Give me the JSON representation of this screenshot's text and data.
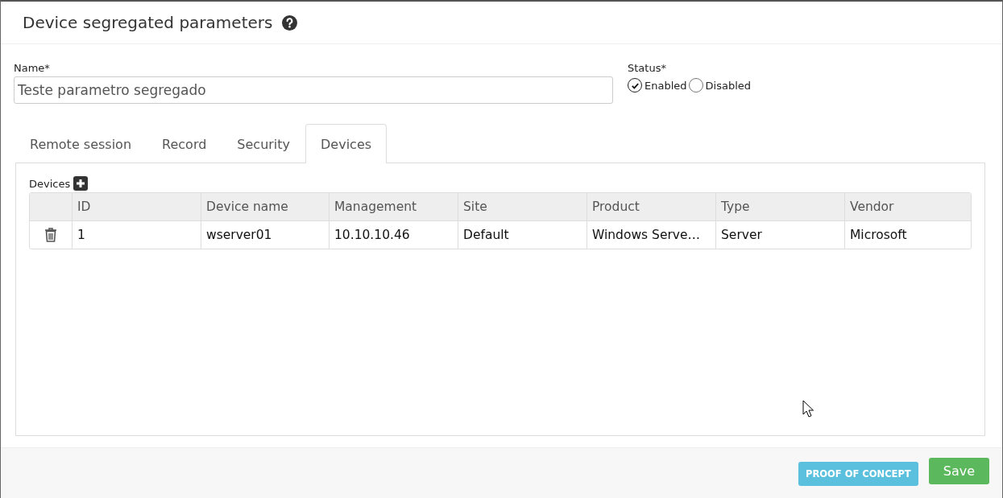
{
  "header": {
    "title": "Device segregated parameters"
  },
  "name_field": {
    "label": "Name",
    "required_mark": "*",
    "value": "Teste parametro segregado"
  },
  "status": {
    "label": "Status",
    "required_mark": "*",
    "options": [
      {
        "label": "Enabled",
        "selected": true
      },
      {
        "label": "Disabled",
        "selected": false
      }
    ]
  },
  "tabs": [
    {
      "label": "Remote session",
      "selected": false
    },
    {
      "label": "Record",
      "selected": false
    },
    {
      "label": "Security",
      "selected": false
    },
    {
      "label": "Devices",
      "selected": true
    }
  ],
  "devices": {
    "label": "Devices",
    "table": {
      "columns": [
        "ID",
        "Device name",
        "Management",
        "Site",
        "Product",
        "Type",
        "Vendor"
      ],
      "rows": [
        [
          "1",
          "wserver01",
          "10.10.10.46",
          "Default",
          "Windows Serve…",
          "Server",
          "Microsoft"
        ]
      ]
    }
  },
  "footer": {
    "buttons": [
      {
        "label": "PROOF OF CONCEPT",
        "kind": "info"
      },
      {
        "label": "Save",
        "kind": "primary"
      }
    ]
  }
}
